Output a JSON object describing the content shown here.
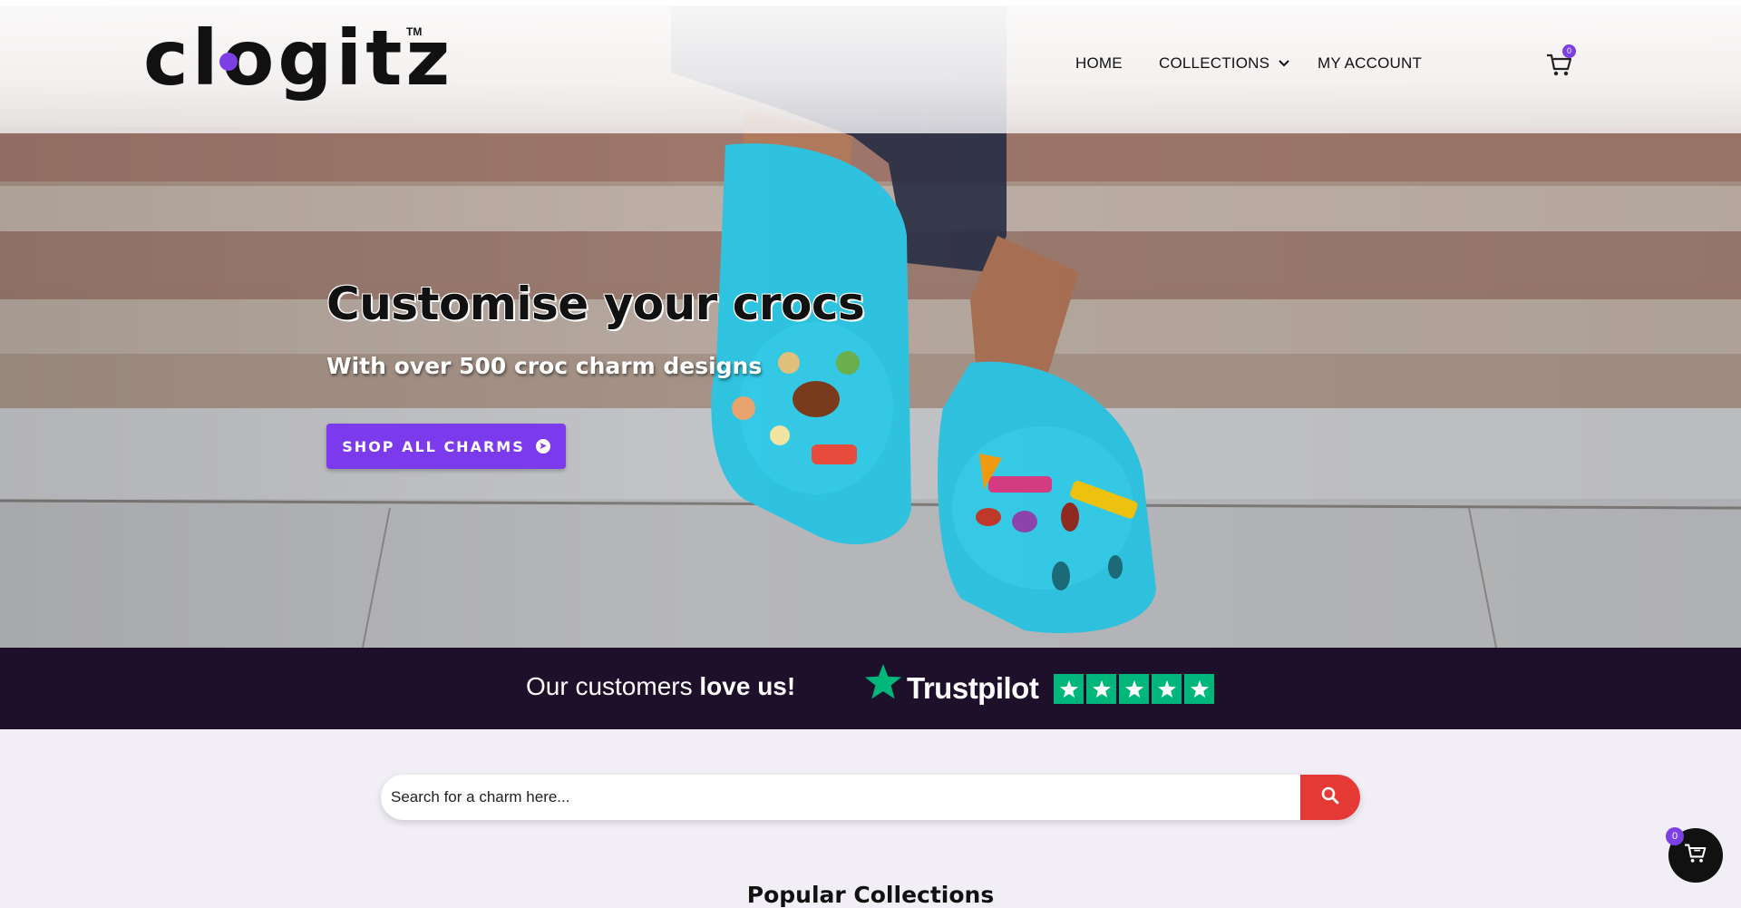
{
  "header": {
    "logo_text": "clogitz",
    "logo_tm": "TM",
    "nav": {
      "home": "HOME",
      "collections": "COLLECTIONS",
      "my_account": "MY ACCOUNT"
    },
    "cart_count": "0"
  },
  "hero": {
    "headline": "Customise your crocs",
    "subline": "With over 500 croc charm designs",
    "cta_label": "SHOP ALL CHARMS"
  },
  "trustpilot": {
    "tagline_prefix": "Our customers",
    "tagline_bold": "love us!",
    "brand": "Trustpilot",
    "stars": 5
  },
  "search": {
    "placeholder": "Search for a charm here..."
  },
  "popular": {
    "title": "Popular Collections"
  },
  "floating_cart": {
    "count": "0"
  },
  "colors": {
    "accent_purple": "#7c3aed",
    "trustpilot_green": "#00b67a",
    "search_red": "#e53935",
    "band_dark": "#1e0f2b"
  }
}
